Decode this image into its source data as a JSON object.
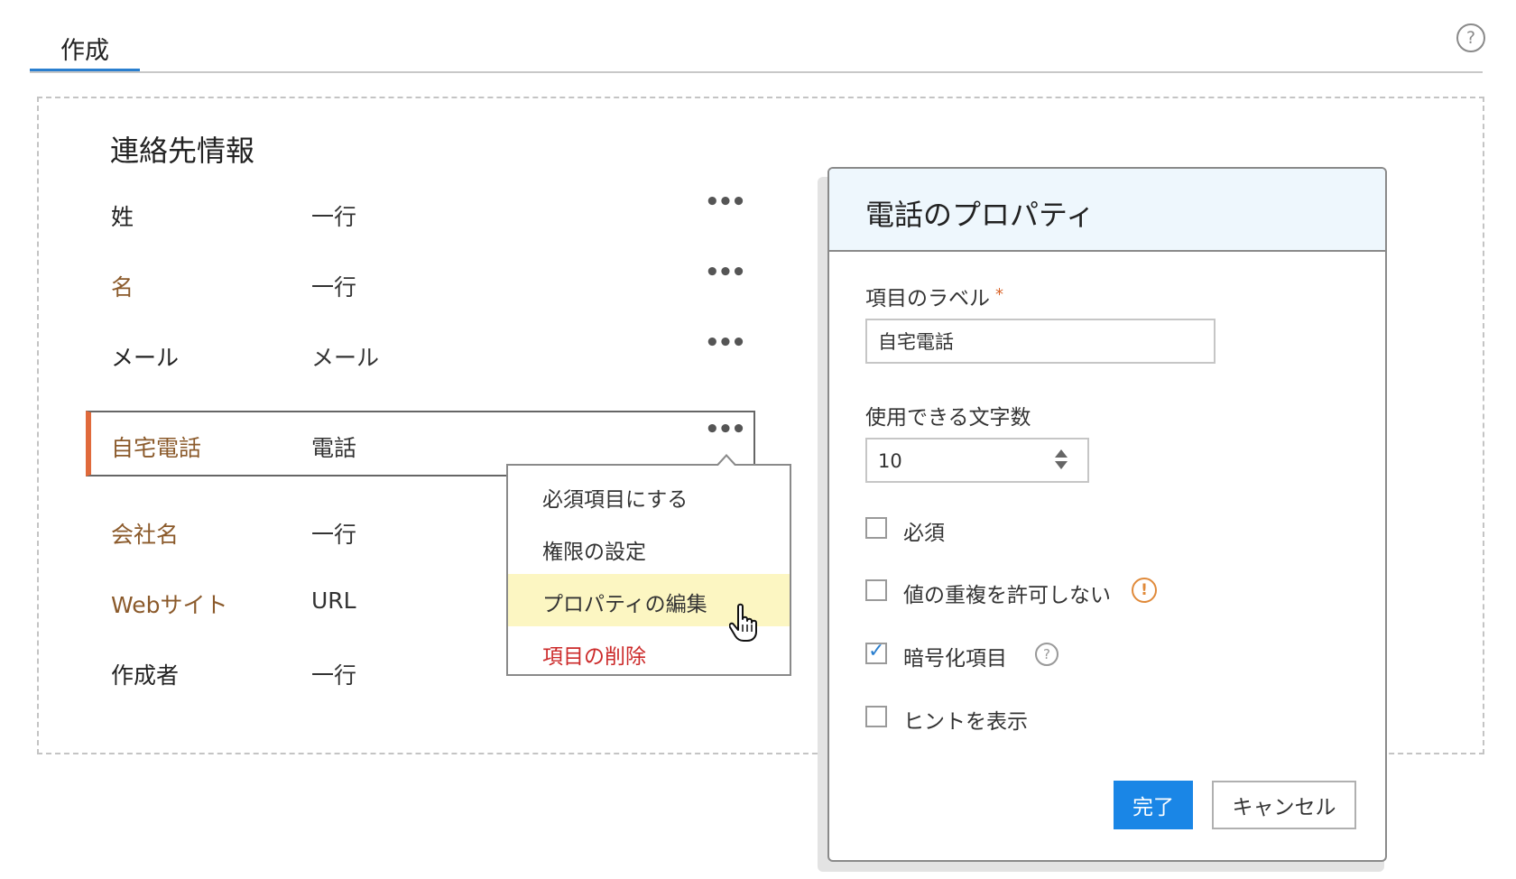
{
  "tabs": [
    {
      "label": "作成"
    }
  ],
  "help_icon": "question-circle-icon",
  "section": {
    "title": "連絡先情報",
    "fields": [
      {
        "label": "姓",
        "type": "一行",
        "more": "•••"
      },
      {
        "label": "名",
        "type": "一行",
        "more": "•••"
      },
      {
        "label": "メール",
        "type": "メール",
        "more": "•••"
      },
      {
        "label": "自宅電話",
        "type": "電話",
        "more": "•••"
      },
      {
        "label": "会社名",
        "type": "一行"
      },
      {
        "label": "Webサイト",
        "type": "URL"
      },
      {
        "label": "作成者",
        "type": "一行"
      }
    ]
  },
  "context_menu": {
    "items": [
      {
        "label": "必須項目にする"
      },
      {
        "label": "権限の設定"
      },
      {
        "label": "プロパティの編集"
      },
      {
        "label": "項目の削除"
      }
    ]
  },
  "dialog": {
    "title": "電話のプロパティ",
    "field_label": {
      "label": "項目のラベル",
      "required_mark": "*",
      "value": "自宅電話"
    },
    "max_chars": {
      "label": "使用できる文字数",
      "value": "10"
    },
    "options": [
      {
        "label": "必須",
        "checked": false
      },
      {
        "label": "値の重複を許可しない",
        "checked": false,
        "icon": "!"
      },
      {
        "label": "暗号化項目",
        "checked": true,
        "icon": "?"
      },
      {
        "label": "ヒントを表示",
        "checked": false
      }
    ],
    "done_label": "完了",
    "cancel_label": "キャンセル"
  },
  "colors": {
    "accent": "#1a86e6",
    "selected_bar": "#e06a3b",
    "field_brown": "#8b5a2b",
    "danger": "#cc2a2a",
    "menu_highlight": "#fcf6c2"
  }
}
